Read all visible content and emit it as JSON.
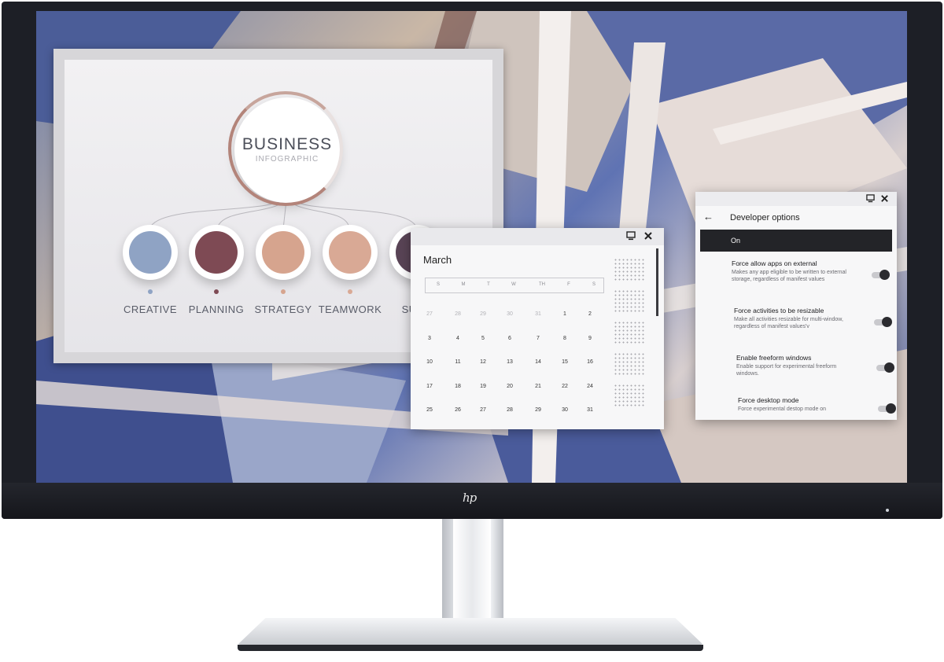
{
  "presentation": {
    "title": "BUSINESS",
    "subtitle": "INFOGRAPHIC",
    "steps": [
      {
        "label": "CREATIVE",
        "color": "#8fa3c4"
      },
      {
        "label": "PLANNING",
        "color": "#7e4a54"
      },
      {
        "label": "STRATEGY",
        "color": "#d6a48e"
      },
      {
        "label": "TEAMWORK",
        "color": "#d9a995"
      },
      {
        "label": "SUCC",
        "color": "#594456"
      }
    ]
  },
  "calendar": {
    "month": "March",
    "weekdays": [
      "S",
      "M",
      "T",
      "W",
      "TH",
      "F",
      "S"
    ],
    "weeks": [
      [
        "27",
        "28",
        "29",
        "30",
        "31",
        "1",
        "2"
      ],
      [
        "3",
        "4",
        "5",
        "6",
        "7",
        "8",
        "9"
      ],
      [
        "10",
        "11",
        "12",
        "13",
        "14",
        "15",
        "16"
      ],
      [
        "17",
        "18",
        "19",
        "20",
        "21",
        "22",
        "24"
      ],
      [
        "25",
        "26",
        "27",
        "28",
        "29",
        "30",
        "31"
      ]
    ],
    "icons": {
      "restore": "restore-icon",
      "close": "close-icon"
    }
  },
  "developer": {
    "back_icon": "←",
    "title": "Developer options",
    "master_label": "On",
    "items": [
      {
        "title": "Force allow apps on external",
        "desc": "Makes any app eligible to be written to external storage, regardless of manifest values",
        "enabled": true
      },
      {
        "title": "Force activities to be resizable",
        "desc": "Make all activities resizable for multi-window, regardless of manifest values'v",
        "enabled": true
      },
      {
        "title": "Enable freeform windows",
        "desc": "Enable support for experimental freeform windows.",
        "enabled": true
      },
      {
        "title": "Force desktop mode",
        "desc": "Force experimental destop mode on",
        "enabled": true
      }
    ]
  },
  "monitor": {
    "logo": "hp"
  }
}
